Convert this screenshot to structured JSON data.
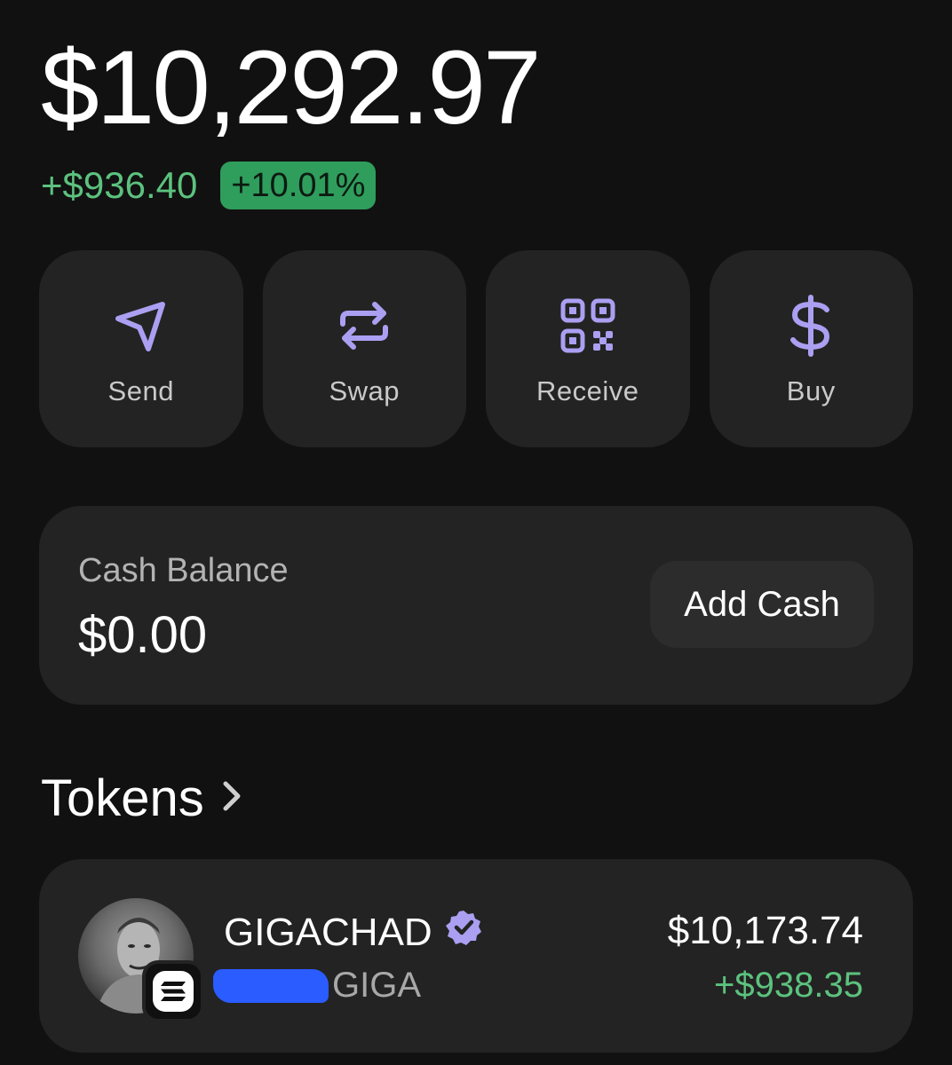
{
  "portfolio": {
    "balance": "$10,292.97",
    "change_amount": "+$936.40",
    "change_percent": "+10.01%"
  },
  "actions": [
    {
      "label": "Send",
      "icon": "send-icon"
    },
    {
      "label": "Swap",
      "icon": "swap-icon"
    },
    {
      "label": "Receive",
      "icon": "qr-code-icon"
    },
    {
      "label": "Buy",
      "icon": "dollar-icon"
    }
  ],
  "cash": {
    "label": "Cash Balance",
    "value": "$0.00",
    "button": "Add Cash"
  },
  "tokens": {
    "title": "Tokens",
    "items": [
      {
        "name": "GIGACHAD",
        "symbol": "GIGA",
        "value": "$10,173.74",
        "change": "+$938.35",
        "verified": true
      }
    ]
  },
  "colors": {
    "background": "#111111",
    "card": "#232323",
    "accent_purple": "#ab9ff2",
    "positive_green": "#5cc27e",
    "badge_green": "#2f9d5c"
  }
}
